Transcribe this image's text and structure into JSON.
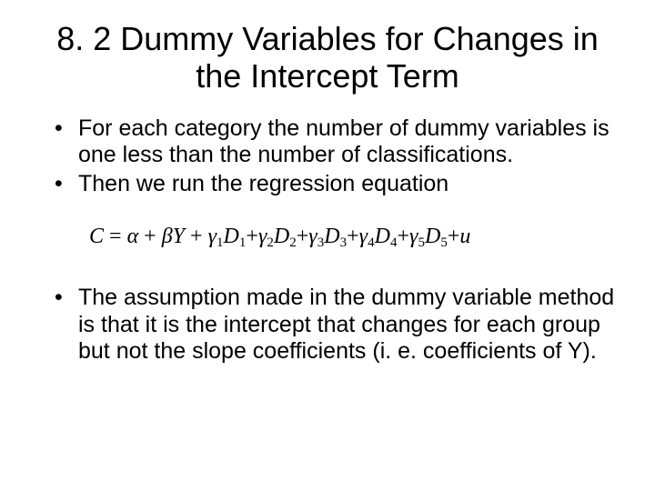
{
  "title": "8. 2 Dummy Variables for Changes in the Intercept Term",
  "bullets_top": [
    "For each category the number of dummy variables is one less than the number of classifications.",
    "Then we run the regression equation"
  ],
  "equation": {
    "lhs": "C",
    "eq": " = ",
    "terms": [
      {
        "sym": "α",
        "sub": ""
      },
      {
        "plus": " + ",
        "sym": "β",
        "var": "Y"
      },
      {
        "plus": " + ",
        "sym": "γ",
        "sub": "1",
        "var": "D",
        "vsub": "1"
      },
      {
        "plus": "+",
        "sym": "γ",
        "sub": "2",
        "var": "D",
        "vsub": "2"
      },
      {
        "plus": "+",
        "sym": "γ",
        "sub": "3",
        "var": "D",
        "vsub": "3"
      },
      {
        "plus": "+",
        "sym": "γ",
        "sub": "4",
        "var": "D",
        "vsub": "4"
      },
      {
        "plus": "+",
        "sym": "γ",
        "sub": "5",
        "var": "D",
        "vsub": "5"
      },
      {
        "plus": "+",
        "sym": "u"
      }
    ]
  },
  "bullets_bottom": [
    "The assumption made in the dummy variable method is that it is the intercept that changes for each group but not the slope coefficients (i. e. coefficients of Y)."
  ]
}
